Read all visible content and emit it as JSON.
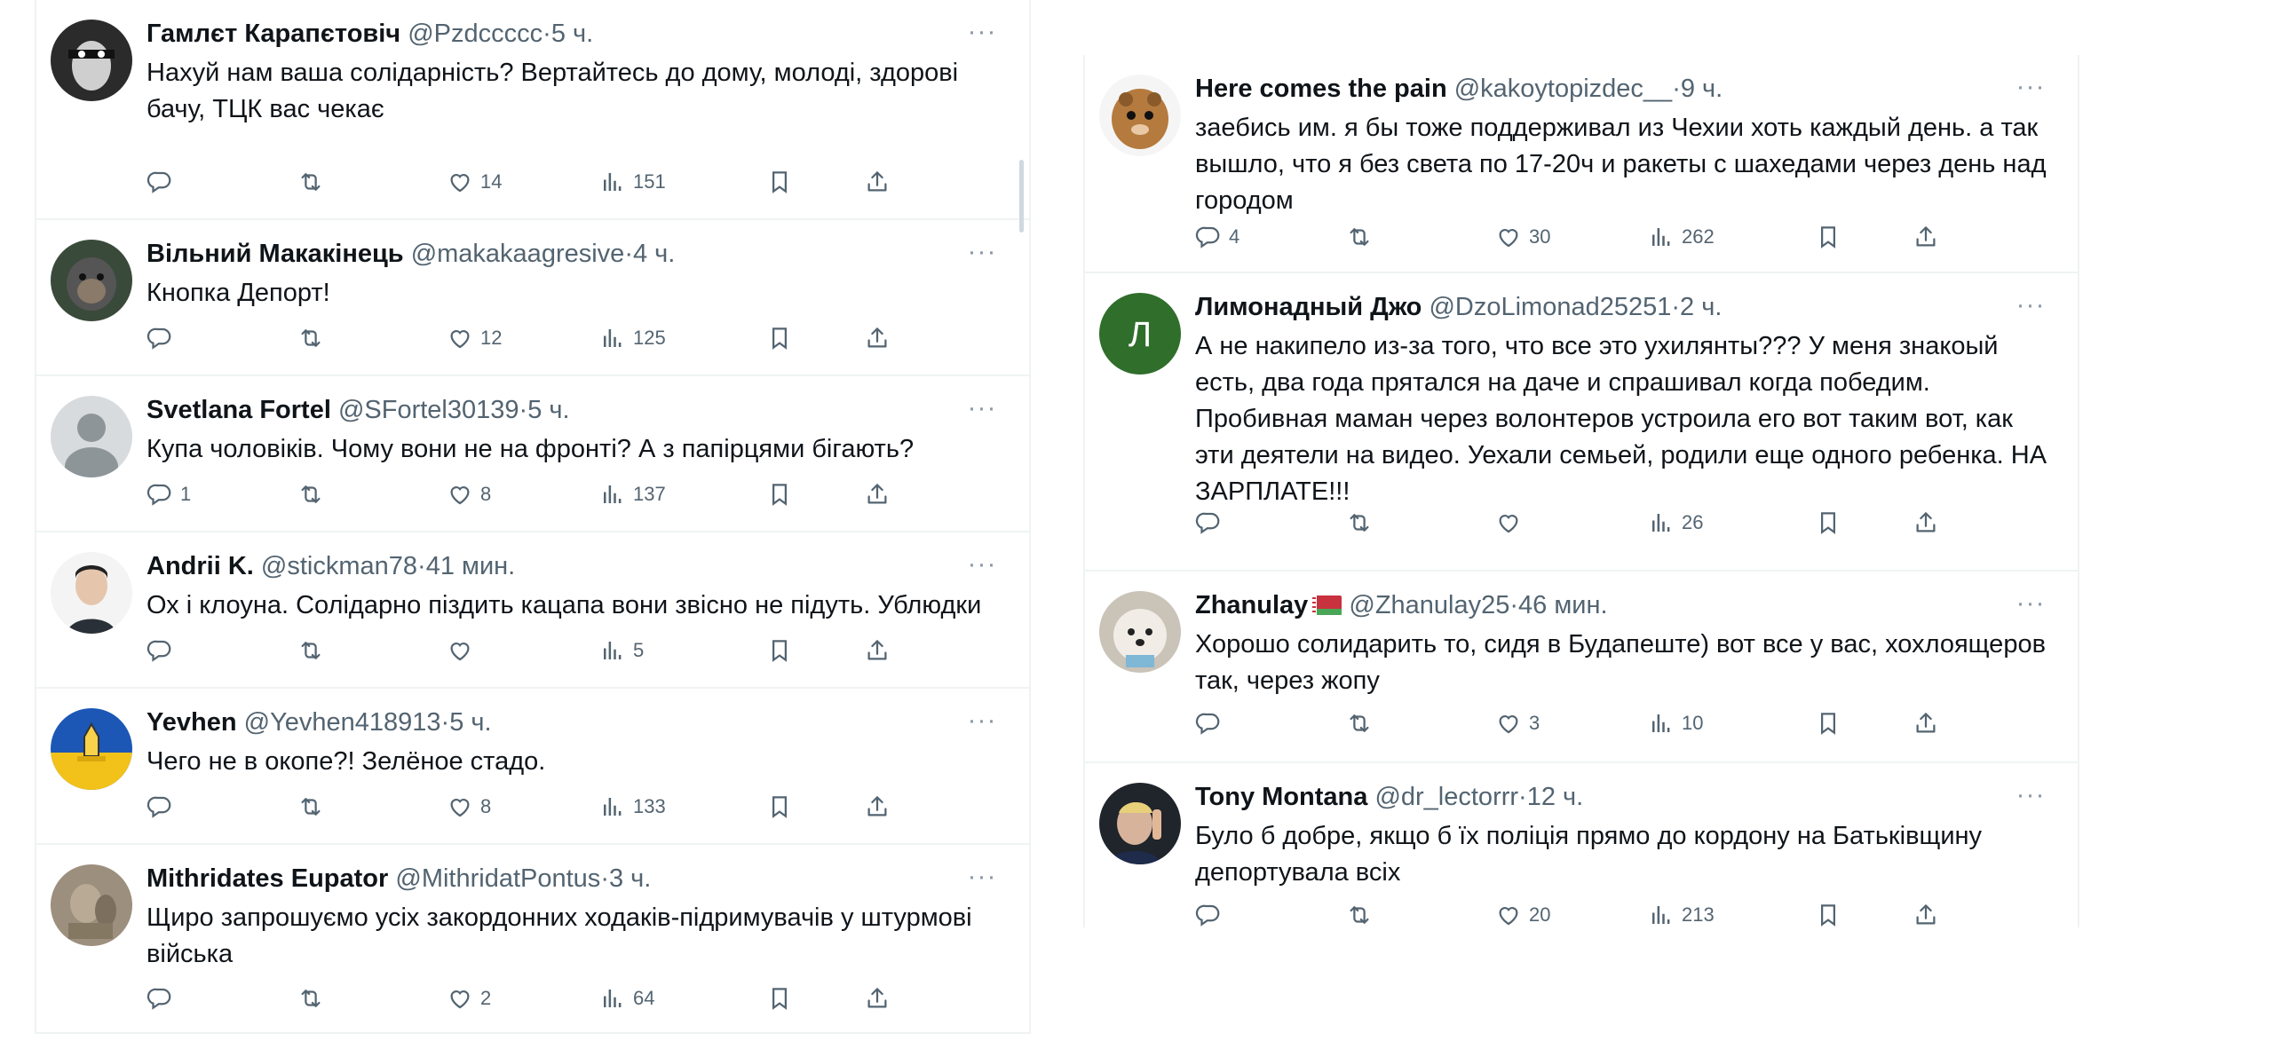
{
  "left_column": [
    {
      "name": "Гамлєт Карапєтовіч",
      "handle": "@Pzdccccc",
      "sep": "·",
      "time": "5 ч.",
      "text": "Нахуй нам ваша солідарність? Вертайтесь до дому, молоді, здорові бачу, ТЦК вас чекає",
      "replies": "",
      "retweets": "",
      "likes": "14",
      "views": "151"
    },
    {
      "name": "Вільний Макакінець",
      "handle": "@makakaagresive",
      "sep": "·",
      "time": "4 ч.",
      "text": "Кнопка Депорт!",
      "replies": "",
      "retweets": "",
      "likes": "12",
      "views": "125"
    },
    {
      "name": "Svetlana Fortel",
      "handle": "@SFortel30139",
      "sep": "·",
      "time": "5 ч.",
      "text": "Купа чоловіків. Чому вони не на фронті? А з папірцями бігають?",
      "replies": "1",
      "retweets": "",
      "likes": "8",
      "views": "137"
    },
    {
      "name": "Andrii K.",
      "handle": "@stickman78",
      "sep": "·",
      "time": "41 мин.",
      "text": "Ох і клоуна. Солідарно піздить кацапа вони звісно не підуть. Ублюдки",
      "replies": "",
      "retweets": "",
      "likes": "",
      "views": "5"
    },
    {
      "name": "Yevhen",
      "handle": "@Yevhen418913",
      "sep": "·",
      "time": "5 ч.",
      "text": "Чего не в окопе?! Зелёное стадо.",
      "replies": "",
      "retweets": "",
      "likes": "8",
      "views": "133"
    },
    {
      "name": "Mithridates Eupator",
      "handle": "@MithridatPontus",
      "sep": "·",
      "time": "3 ч.",
      "text": "Щиро запрошуємо усіх закордонних ходаків-підримувачів у штурмові війська",
      "replies": "",
      "retweets": "",
      "likes": "2",
      "views": "64"
    }
  ],
  "right_column": [
    {
      "name": "Here comes the pain",
      "handle": "@kakoytopizdec__",
      "sep": "·",
      "time": "9 ч.",
      "text": "заебись им. я бы тоже поддерживал из Чехии хоть каждый день. а так вышло, что я без света по 17-20ч и ракеты с шахедами через день над городом",
      "replies": "4",
      "retweets": "",
      "likes": "30",
      "views": "262"
    },
    {
      "name": "Лимонадный Джо",
      "handle": "@DzoLimonad25251",
      "sep": "·",
      "time": "2 ч.",
      "avatar_letter": "Л",
      "text": "А не накипело из-за того, что все это ухилянты??? У меня знакоый есть, два года прятался на даче и спрашивал когда победим. Пробивная маман через волонтеров устроила его вот таким вот, как эти деятели на видео. Уехали семьей, родили еще одного ребенка. НА ЗАРПЛАТЕ!!!",
      "replies": "",
      "retweets": "",
      "likes": "",
      "views": "26"
    },
    {
      "name": "Zhanulay",
      "handle": "@Zhanulay25",
      "sep": "·",
      "time": "46 мин.",
      "text": "Хорошо солидарить то, сидя в Будапеште) вот все у вас, хохлоящеров так, через жопу",
      "replies": "",
      "retweets": "",
      "likes": "3",
      "views": "10"
    },
    {
      "name": "Tony Montana",
      "handle": "@dr_lectorrr",
      "sep": "·",
      "time": "12 ч.",
      "text": "Було б добре, якщо б їх поліція прямо до кордону на Батьківщину депортувала всіх",
      "replies": "",
      "retweets": "",
      "likes": "20",
      "views": "213"
    }
  ],
  "icons": {
    "reply": "reply-icon",
    "retweet": "retweet-icon",
    "like": "heart-icon",
    "views": "views-icon",
    "bookmark": "bookmark-icon",
    "share": "share-icon",
    "more": "more-icon"
  },
  "colors": {
    "text": "#0f1419",
    "meta": "#536471",
    "divider": "#eff3f4",
    "limonad_avatar": "#2f6e2b"
  }
}
